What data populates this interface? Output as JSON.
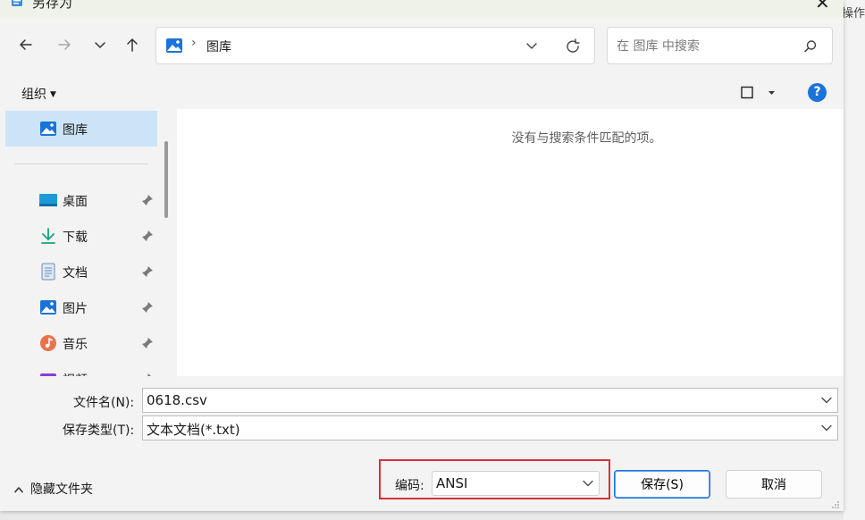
{
  "background": {
    "partial_text": "操作"
  },
  "dialog": {
    "title": "另存为",
    "accent_color": "#1a73d9",
    "highlight_color": "#d9303a"
  },
  "navigation": {
    "back_icon": "arrow-left-icon",
    "forward_icon": "arrow-right-icon",
    "recent_icon": "chevron-down-icon",
    "up_icon": "arrow-up-icon"
  },
  "address_bar": {
    "separator": "›",
    "crumb": "图库"
  },
  "search": {
    "placeholder": "在 图库 中搜索"
  },
  "toolbar": {
    "organize_label": "组织",
    "help_label": "?"
  },
  "sidebar": {
    "items": [
      {
        "label": "图库",
        "icon": "gallery-icon",
        "selected": true,
        "pinned": false
      },
      {
        "label": "桌面",
        "icon": "desktop-icon",
        "pinned": true
      },
      {
        "label": "下载",
        "icon": "download-icon",
        "pinned": true
      },
      {
        "label": "文档",
        "icon": "document-icon",
        "pinned": true
      },
      {
        "label": "图片",
        "icon": "pictures-icon",
        "pinned": true
      },
      {
        "label": "音乐",
        "icon": "music-icon",
        "pinned": true
      },
      {
        "label": "视频",
        "icon": "video-icon",
        "pinned": true
      }
    ]
  },
  "content": {
    "empty_message": "没有与搜索条件匹配的项。"
  },
  "form": {
    "filename_label": "文件名(N):",
    "filename_value": "0618.csv",
    "filetype_label": "保存类型(T):",
    "filetype_value": "文本文档(*.txt)",
    "encoding_label": "编码:",
    "encoding_value": "ANSI",
    "hide_folders_label": "隐藏文件夹",
    "save_label": "保存(S)",
    "cancel_label": "取消"
  }
}
